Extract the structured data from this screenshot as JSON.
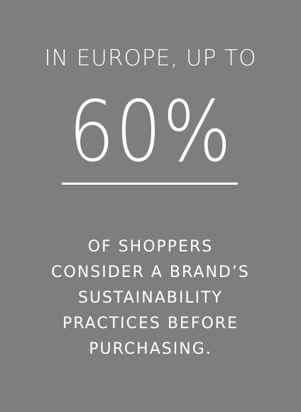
{
  "card": {
    "lead_text": "IN EUROPE, UP TO",
    "stat_value": "60%",
    "body_lines": [
      "OF SHOPPERS",
      "CONSIDER A BRAND’S",
      "SUSTAINABILITY",
      "PRACTICES BEFORE",
      "PURCHASING."
    ],
    "background_color": "#7e7e7e",
    "text_color": "#ffffff"
  }
}
